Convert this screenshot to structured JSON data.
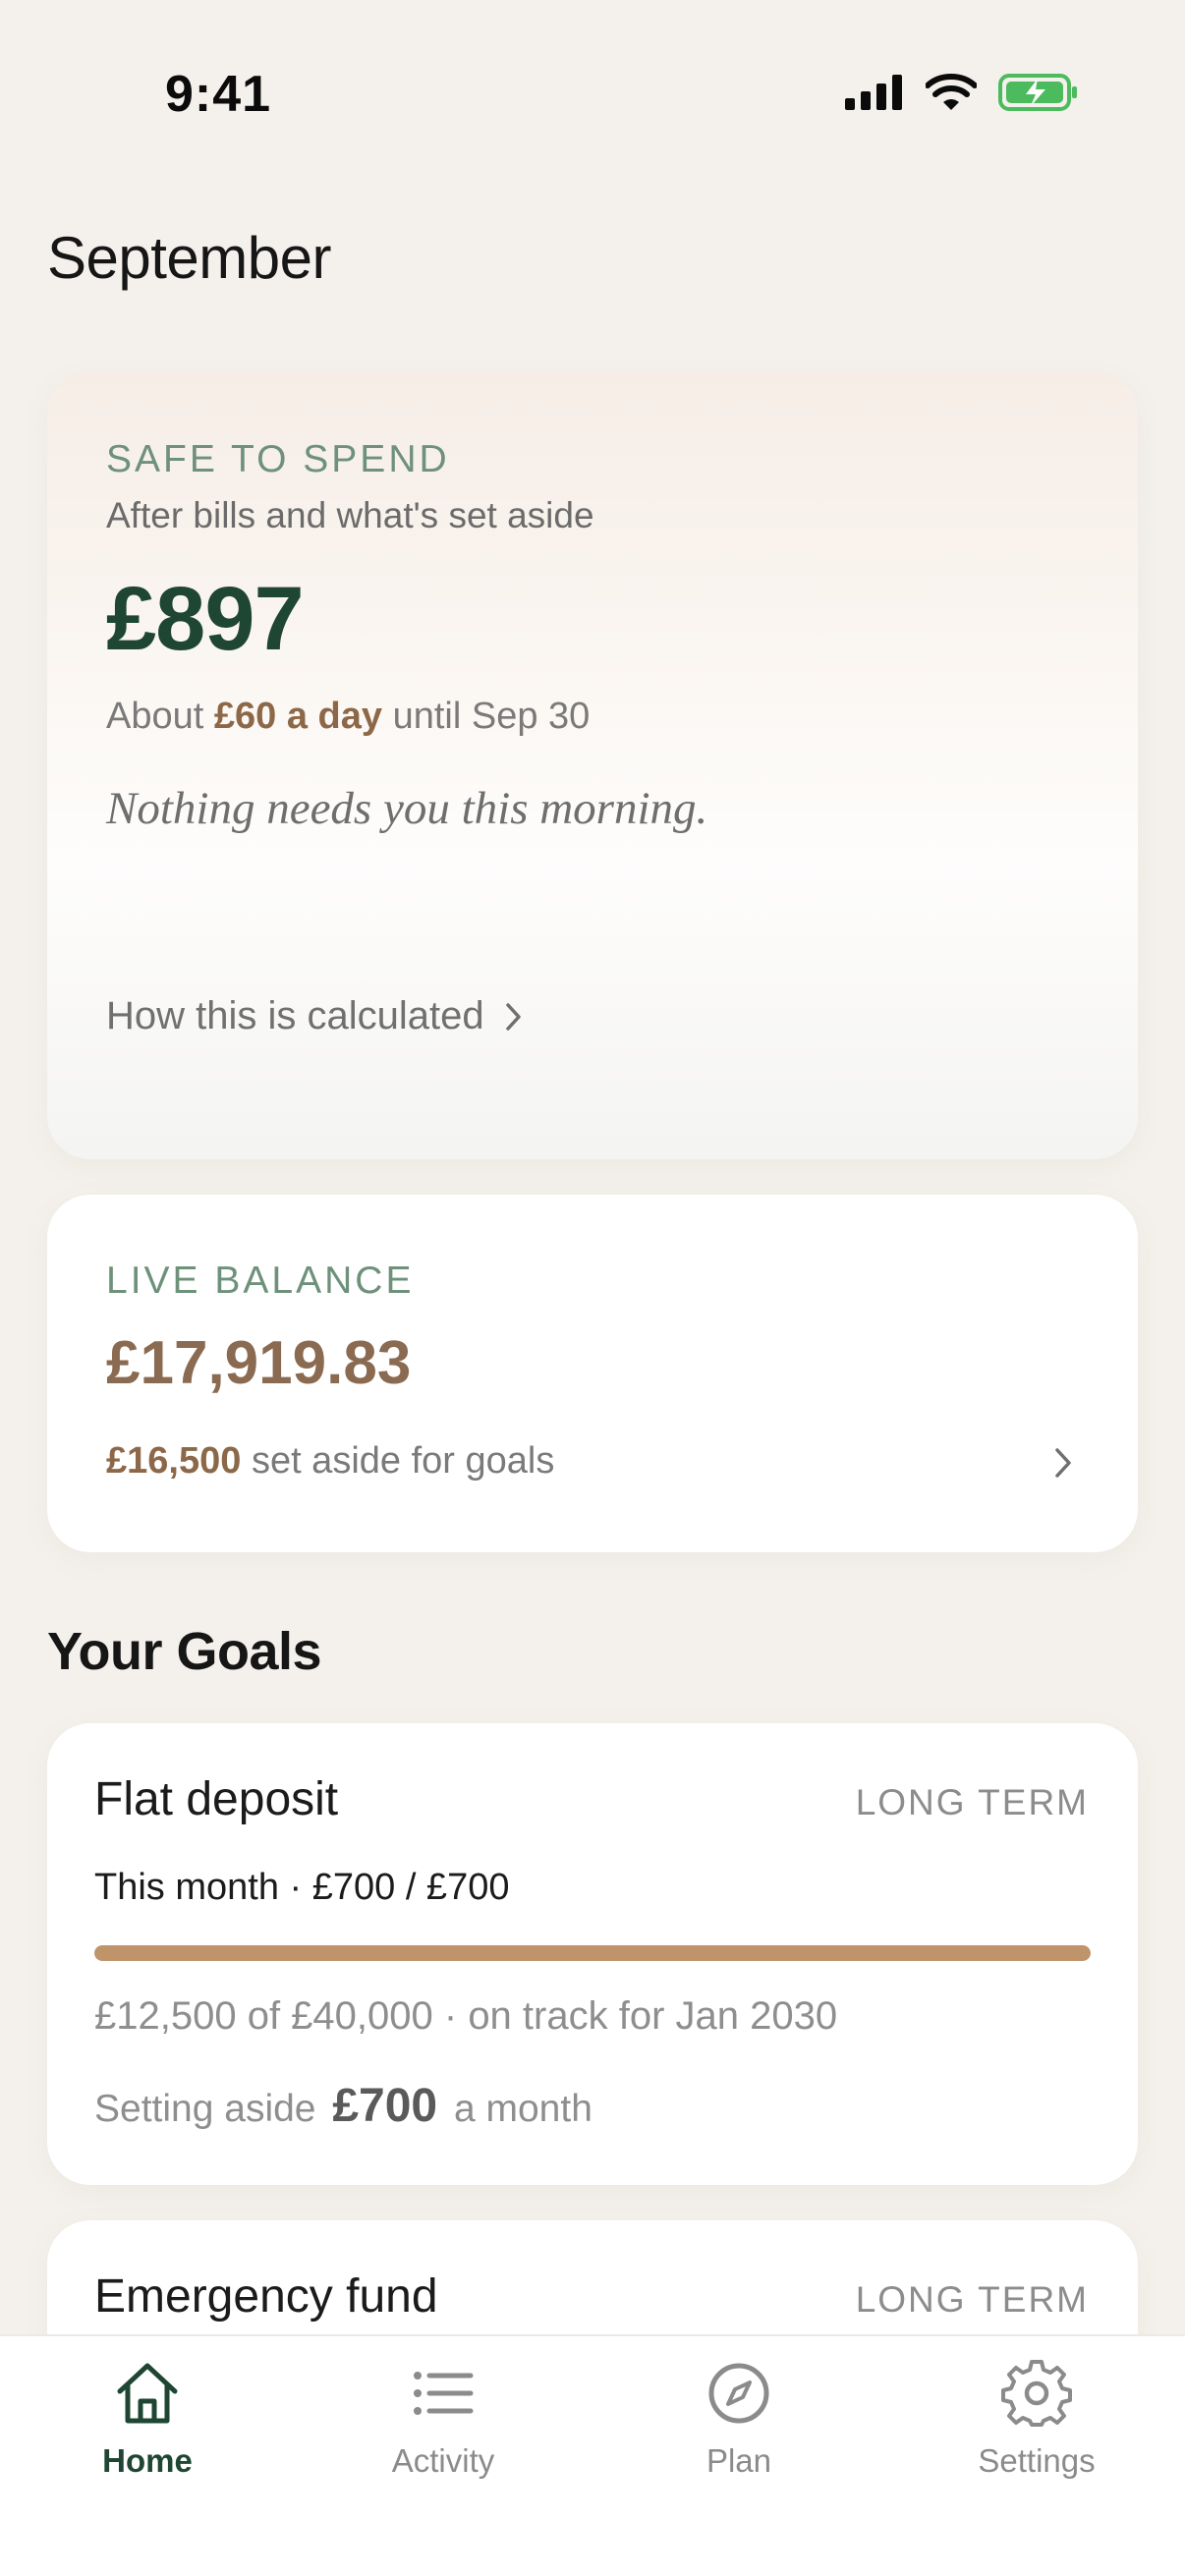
{
  "status_bar": {
    "time": "9:41"
  },
  "header": {
    "month": "September"
  },
  "safe_to_spend": {
    "eyebrow": "SAFE TO SPEND",
    "subtitle": "After bills and what's set aside",
    "amount": "£897",
    "daily_prefix": "About",
    "daily_amount": "£60 a day",
    "daily_suffix": "until Sep 30",
    "note": "Nothing needs you this morning.",
    "calc_link": "How this is calculated"
  },
  "live_balance": {
    "eyebrow": "LIVE BALANCE",
    "amount": "£17,919.83",
    "goals_amount": "£16,500",
    "goals_suffix": "set aside for goals"
  },
  "goals_section": {
    "title": "Your Goals"
  },
  "goals": [
    {
      "name": "Flat deposit",
      "term": "LONG TERM",
      "month_progress": "This month · £700 / £700",
      "progress_fraction": 1.0,
      "status": "£12,500 of £40,000 · on track for Jan 2030",
      "aside_prefix": "Setting aside",
      "aside_amount": "£700",
      "aside_suffix": "a month"
    },
    {
      "name": "Emergency fund",
      "term": "LONG TERM"
    }
  ],
  "tab_bar": {
    "tabs": [
      {
        "label": "Home",
        "icon": "home-icon",
        "active": true
      },
      {
        "label": "Activity",
        "icon": "list-icon",
        "active": false
      },
      {
        "label": "Plan",
        "icon": "compass-icon",
        "active": false
      },
      {
        "label": "Settings",
        "icon": "gear-icon",
        "active": false
      }
    ]
  },
  "colors": {
    "background": "#f4f1ec",
    "accent_green": "#1f4632",
    "eyebrow_green": "#6d917a",
    "brown": "#8c6848",
    "progress": "#c0946a"
  }
}
